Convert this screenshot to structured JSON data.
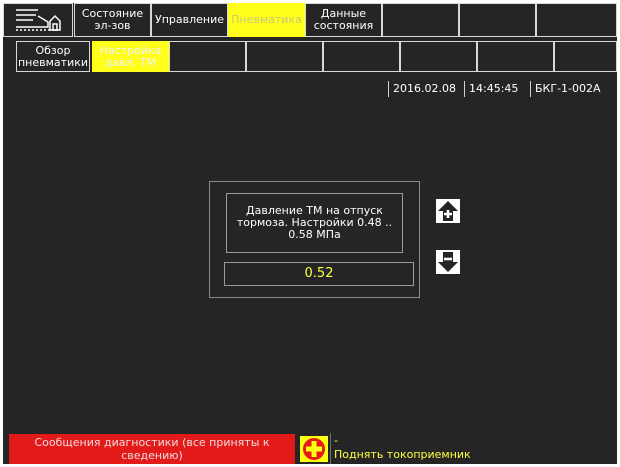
{
  "top_tabs": [
    {
      "label": "",
      "icon": "home-train-icon"
    },
    {
      "label": "Состояние\nэл-зов"
    },
    {
      "label": "Управление"
    },
    {
      "label": "Пневматика",
      "active": true
    },
    {
      "label": "Данные\nсостояния"
    },
    {
      "label": ""
    },
    {
      "label": ""
    },
    {
      "label": ""
    }
  ],
  "sub_tabs": [
    {
      "label": "Обзор\nпневматики"
    },
    {
      "label": "Настройка\nдавл. ТМ",
      "active": true
    },
    {
      "label": ""
    },
    {
      "label": ""
    },
    {
      "label": ""
    },
    {
      "label": ""
    },
    {
      "label": ""
    },
    {
      "label": ""
    }
  ],
  "status": {
    "date": "2016.02.08",
    "time": "14:45:45",
    "unit": "БКГ-1-002A"
  },
  "setting": {
    "description": "Давление ТМ на отпуск тормоза. Настройки  0.48 .. 0.58 МПа",
    "value": "0.52"
  },
  "controls": {
    "up_icon": "arrow-up-plus-icon",
    "down_icon": "arrow-down-minus-icon"
  },
  "bottom_bar": {
    "diagnostics": "Сообщения диагностики (все приняты к сведению)",
    "alarm_icon": "red-cross-icon",
    "alarm_line1": "-",
    "alarm_line2": "Поднять токоприемник"
  },
  "colors": {
    "background": "#252525",
    "active_tab": "#ffff1a",
    "value_text": "#ffff40",
    "diagnostics_bar": "#e21a1a"
  }
}
